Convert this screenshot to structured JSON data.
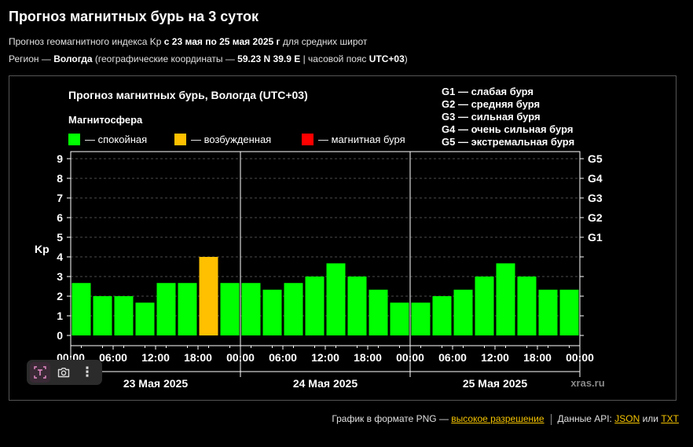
{
  "page": {
    "title": "Прогноз магнитных бурь на 3 суток",
    "subtitle": {
      "prefix": "Прогноз геомагнитного индекса Kp ",
      "dates": "с 23 мая по 25 мая 2025 г",
      "suffix": " для средних широт"
    },
    "region": {
      "prefix": "Регион — ",
      "name": "Вологда",
      "coords_prefix": " (географические координаты — ",
      "coords": "59.23 N 39.9 E",
      "tz_prefix": " | часовой пояс ",
      "tz": "UTC+03",
      "suffix": ")"
    }
  },
  "toolbar": {
    "icons": [
      "text-select-icon",
      "camera-icon",
      "more-vertical-icon"
    ],
    "more_glyph": "⋮"
  },
  "footer": {
    "png_prefix": "График в формате PNG — ",
    "png_link": "высокое разрешение",
    "api_prefix": "Данные API: ",
    "json_link": "JSON",
    "or": " или ",
    "txt_link": "TXT"
  },
  "chart_data": {
    "type": "bar",
    "title": "Прогноз магнитных бурь, Вологда (UTC+03)",
    "legend_title": "Магнитосфера",
    "legend": [
      {
        "label": "— спокойная",
        "color": "#00ff00"
      },
      {
        "label": "— возбужденная",
        "color": "#ffc000"
      },
      {
        "label": "— магнитная буря",
        "color": "#ff0000"
      }
    ],
    "g_scale": [
      "G1 — слабая буря",
      "G2 — средняя буря",
      "G3 — сильная буря",
      "G4 — очень сильная буря",
      "G5 — экстремальная буря"
    ],
    "ylabel": "Kp",
    "ylim": [
      0,
      9
    ],
    "yticks": [
      "0",
      "1",
      "2",
      "3",
      "4",
      "5",
      "6",
      "7",
      "8",
      "9"
    ],
    "right_axis_labels": [
      {
        "kp": 5,
        "label": "G1"
      },
      {
        "kp": 6,
        "label": "G2"
      },
      {
        "kp": 7,
        "label": "G3"
      },
      {
        "kp": 8,
        "label": "G4"
      },
      {
        "kp": 9,
        "label": "G5"
      }
    ],
    "xtick_labels": [
      "00:00",
      "06:00",
      "12:00",
      "18:00",
      "00:00",
      "06:00",
      "12:00",
      "18:00",
      "00:00",
      "06:00",
      "12:00",
      "18:00",
      "00:00"
    ],
    "days": [
      "23 Мая 2025",
      "24 Мая 2025",
      "25 Мая 2025"
    ],
    "watermark": "xras.ru",
    "grid": true,
    "values": [
      2.67,
      2.0,
      2.0,
      1.67,
      2.67,
      2.67,
      4.0,
      2.67,
      2.67,
      2.33,
      2.67,
      3.0,
      3.67,
      3.0,
      2.33,
      1.67,
      1.67,
      2.0,
      2.33,
      3.0,
      3.67,
      3.0,
      2.33,
      2.33
    ],
    "colors": [
      "#00ff00",
      "#00ff00",
      "#00ff00",
      "#00ff00",
      "#00ff00",
      "#00ff00",
      "#ffc000",
      "#00ff00",
      "#00ff00",
      "#00ff00",
      "#00ff00",
      "#00ff00",
      "#00ff00",
      "#00ff00",
      "#00ff00",
      "#00ff00",
      "#00ff00",
      "#00ff00",
      "#00ff00",
      "#00ff00",
      "#00ff00",
      "#00ff00",
      "#00ff00",
      "#00ff00"
    ]
  }
}
